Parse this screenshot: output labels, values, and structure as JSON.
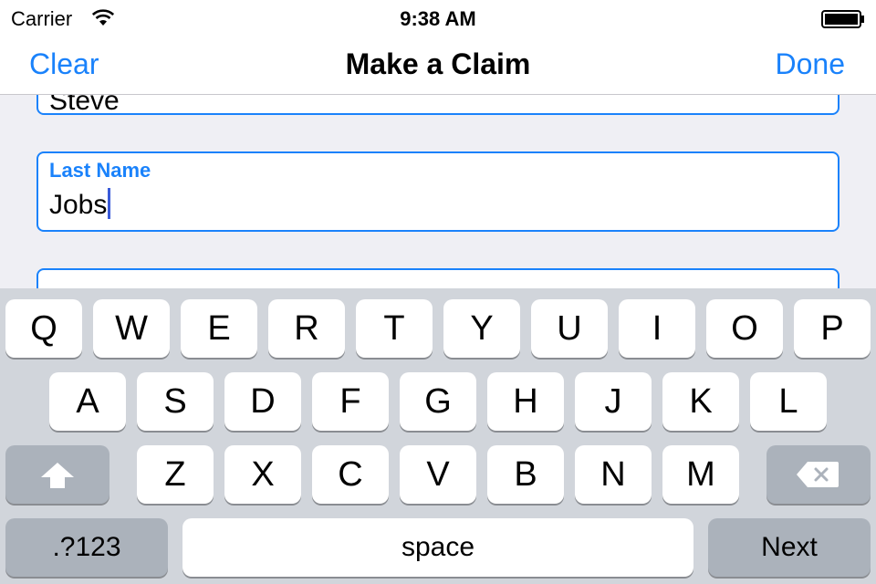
{
  "status_bar": {
    "carrier": "Carrier",
    "time": "9:38 AM"
  },
  "nav": {
    "left_label": "Clear",
    "title": "Make a Claim",
    "right_label": "Done"
  },
  "form": {
    "fields": [
      {
        "label": "",
        "value": "Steve"
      },
      {
        "label": "Last Name",
        "value": "Jobs"
      },
      {
        "label": "",
        "value": ""
      }
    ]
  },
  "keyboard": {
    "row1": [
      "Q",
      "W",
      "E",
      "R",
      "T",
      "Y",
      "U",
      "I",
      "O",
      "P"
    ],
    "row2": [
      "A",
      "S",
      "D",
      "F",
      "G",
      "H",
      "J",
      "K",
      "L"
    ],
    "row3": [
      "Z",
      "X",
      "C",
      "V",
      "B",
      "N",
      "M"
    ],
    "mode_label": ".?123",
    "space_label": "space",
    "return_label": "Next"
  },
  "colors": {
    "accent": "#1a82fb",
    "keyboard_bg": "#d1d5db",
    "key_dark": "#abb2bb"
  }
}
